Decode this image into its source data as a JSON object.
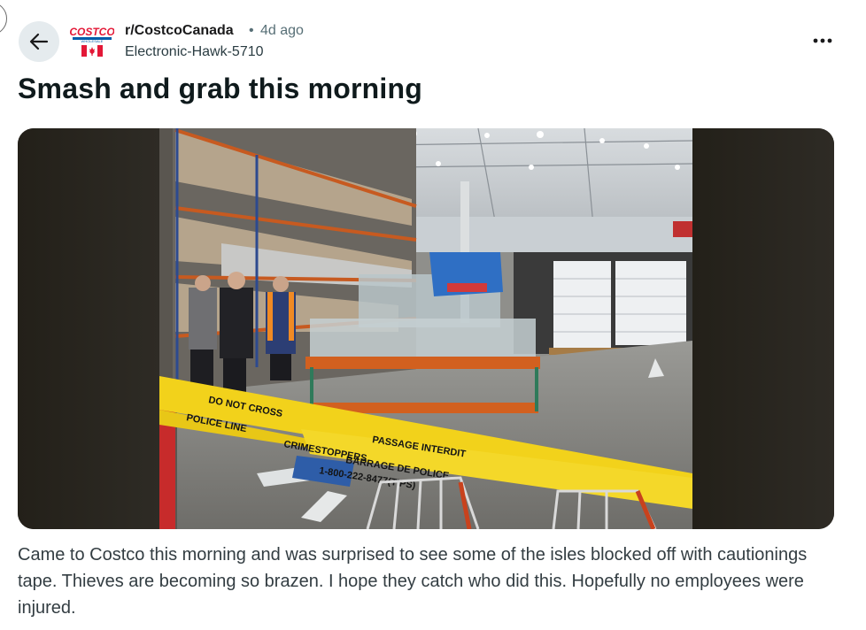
{
  "header": {
    "subreddit": "r/CostcoCanada",
    "separator": "•",
    "age": "4d ago",
    "author": "Electronic-Hawk-5710",
    "more_label": "•••"
  },
  "subreddit_icon": {
    "logo_text": "COSTCO",
    "logo_subtext": "WHOLESALE"
  },
  "post": {
    "title": "Smash and grab this morning",
    "body": "Came to Costco this morning and was surprised to see some of the isles blocked off with cautionings tape. Thieves are becoming so brazen. I hope they catch who did this. Hopefully no employees were injured."
  },
  "image": {
    "tape_line_1": "DO NOT CROSS",
    "tape_line_2": "POLICE LINE",
    "tape_line_3": "PASSAGE INTERDIT",
    "tape_line_4": "BARRAGE DE POLICE",
    "tape_line_5": "CRIMESTOPPERS",
    "tape_line_6": "1-800-222-8477(TIPS)"
  },
  "colors": {
    "accent_red": "#e31837",
    "costco_blue": "#005daa",
    "tape_yellow": "#f2d21b"
  }
}
